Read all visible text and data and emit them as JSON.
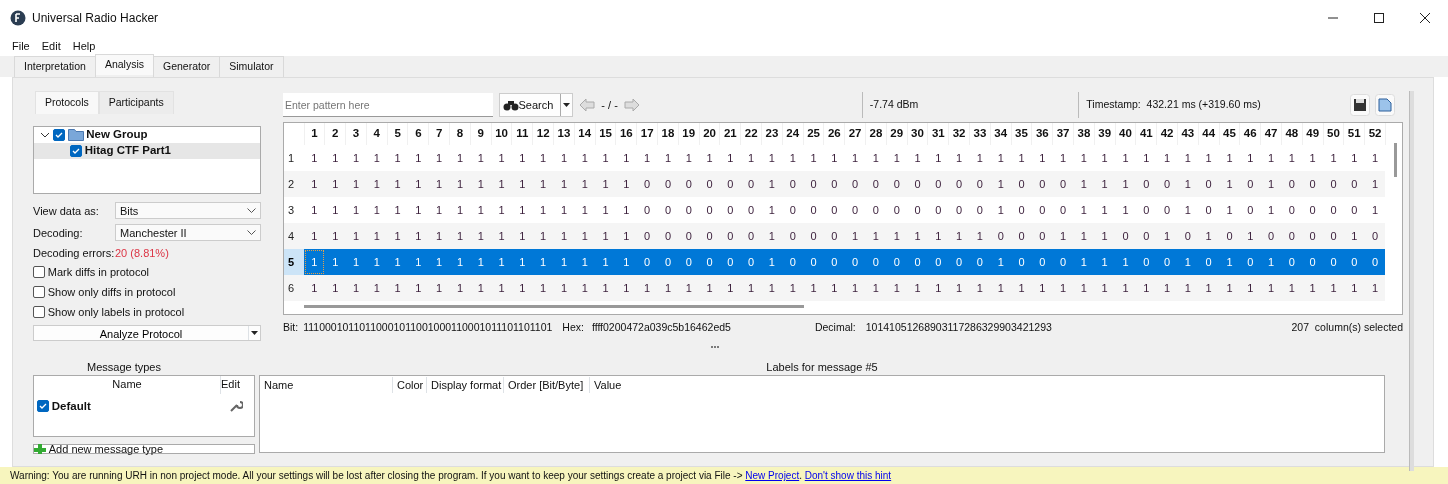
{
  "window": {
    "title": "Universal Radio Hacker"
  },
  "menu": [
    "File",
    "Edit",
    "Help"
  ],
  "tabs": [
    {
      "label": "Interpretation",
      "selected": false
    },
    {
      "label": "Analysis",
      "selected": true
    },
    {
      "label": "Generator",
      "selected": false
    },
    {
      "label": "Simulator",
      "selected": false
    }
  ],
  "protocol_panel": {
    "tabs": [
      {
        "label": "Protocols",
        "selected": true
      },
      {
        "label": "Participants",
        "selected": false
      }
    ],
    "tree": [
      {
        "label": "New Group",
        "checked": true,
        "expanded": true,
        "selected": false,
        "children": [
          {
            "label": "Hitag CTF Part1",
            "checked": true,
            "selected": true
          }
        ]
      }
    ],
    "view_data_as": {
      "label": "View data as:",
      "value": "Bits"
    },
    "decoding": {
      "label": "Decoding:",
      "value": "Manchester II"
    },
    "decoding_errors": {
      "label": "Decoding errors:",
      "value": "20 (8.81%)"
    },
    "options": [
      {
        "label": "Mark diffs in protocol",
        "checked": false
      },
      {
        "label": "Show only diffs in protocol",
        "checked": false
      },
      {
        "label": "Show only labels in protocol",
        "checked": false
      }
    ],
    "analyze_button": "Analyze Protocol"
  },
  "search": {
    "placeholder": "Enter pattern here",
    "button": "Search",
    "position": "- / -"
  },
  "rssi": "-7.74 dBm",
  "timestamp": "Timestamp:  432.21 ms (+319.60 ms)",
  "bit_table": {
    "columns": [
      "1",
      "2",
      "3",
      "4",
      "5",
      "6",
      "7",
      "8",
      "9",
      "10",
      "11",
      "12",
      "13",
      "14",
      "15",
      "16",
      "17",
      "18",
      "19",
      "20",
      "21",
      "22",
      "23",
      "24",
      "25",
      "26",
      "27",
      "28",
      "29",
      "30",
      "31",
      "32",
      "33",
      "34",
      "35",
      "36",
      "37",
      "38",
      "39",
      "40",
      "41",
      "42",
      "43",
      "44",
      "45",
      "46",
      "47",
      "48",
      "49",
      "50",
      "51",
      "52"
    ],
    "rows": [
      {
        "label": "1",
        "cells": [
          "1",
          "1",
          "1",
          "1",
          "1",
          "1",
          "1",
          "1",
          "1",
          "1",
          "1",
          "1",
          "1",
          "1",
          "1",
          "1",
          "1",
          "1",
          "1",
          "1",
          "1",
          "1",
          "1",
          "1",
          "1",
          "1",
          "1",
          "1",
          "1",
          "1",
          "1",
          "1",
          "1",
          "1",
          "1",
          "1",
          "1",
          "1",
          "1",
          "1",
          "1",
          "1",
          "1",
          "1",
          "1",
          "1",
          "1",
          "1",
          "1",
          "1",
          "1",
          "1"
        ],
        "selected": false
      },
      {
        "label": "2",
        "cells": [
          "1",
          "1",
          "1",
          "1",
          "1",
          "1",
          "1",
          "1",
          "1",
          "1",
          "1",
          "1",
          "1",
          "1",
          "1",
          "1",
          "0",
          "0",
          "0",
          "0",
          "0",
          "0",
          "1",
          "0",
          "0",
          "0",
          "0",
          "0",
          "0",
          "0",
          "0",
          "0",
          "0",
          "1",
          "0",
          "0",
          "0",
          "1",
          "1",
          "1",
          "0",
          "0",
          "1",
          "0",
          "1",
          "0",
          "1",
          "0",
          "0",
          "0",
          "0",
          "1"
        ],
        "selected": false
      },
      {
        "label": "3",
        "cells": [
          "1",
          "1",
          "1",
          "1",
          "1",
          "1",
          "1",
          "1",
          "1",
          "1",
          "1",
          "1",
          "1",
          "1",
          "1",
          "1",
          "0",
          "0",
          "0",
          "0",
          "0",
          "0",
          "1",
          "0",
          "0",
          "0",
          "0",
          "0",
          "0",
          "0",
          "0",
          "0",
          "0",
          "1",
          "0",
          "0",
          "0",
          "1",
          "1",
          "1",
          "0",
          "0",
          "1",
          "0",
          "1",
          "0",
          "1",
          "0",
          "0",
          "0",
          "0",
          "1"
        ],
        "selected": false
      },
      {
        "label": "4",
        "cells": [
          "1",
          "1",
          "1",
          "1",
          "1",
          "1",
          "1",
          "1",
          "1",
          "1",
          "1",
          "1",
          "1",
          "1",
          "1",
          "1",
          "0",
          "0",
          "0",
          "0",
          "0",
          "0",
          "1",
          "0",
          "0",
          "0",
          "1",
          "1",
          "1",
          "1",
          "1",
          "1",
          "1",
          "0",
          "0",
          "0",
          "1",
          "1",
          "1",
          "0",
          "0",
          "1",
          "0",
          "1",
          "0",
          "1",
          "0",
          "0",
          "0",
          "0",
          "1",
          "0"
        ],
        "selected": false
      },
      {
        "label": "5",
        "cells": [
          "1",
          "1",
          "1",
          "1",
          "1",
          "1",
          "1",
          "1",
          "1",
          "1",
          "1",
          "1",
          "1",
          "1",
          "1",
          "1",
          "0",
          "0",
          "0",
          "0",
          "0",
          "0",
          "1",
          "0",
          "0",
          "0",
          "0",
          "0",
          "0",
          "0",
          "0",
          "0",
          "0",
          "1",
          "0",
          "0",
          "0",
          "1",
          "1",
          "1",
          "0",
          "0",
          "1",
          "0",
          "1",
          "0",
          "1",
          "0",
          "0",
          "0",
          "0",
          "0"
        ],
        "selected": true
      },
      {
        "label": "6",
        "cells": [
          "1",
          "1",
          "1",
          "1",
          "1",
          "1",
          "1",
          "1",
          "1",
          "1",
          "1",
          "1",
          "1",
          "1",
          "1",
          "1",
          "1",
          "1",
          "1",
          "1",
          "1",
          "1",
          "1",
          "1",
          "1",
          "1",
          "1",
          "1",
          "1",
          "1",
          "1",
          "1",
          "1",
          "1",
          "1",
          "1",
          "1",
          "1",
          "1",
          "1",
          "1",
          "1",
          "1",
          "1",
          "1",
          "1",
          "1",
          "1",
          "1",
          "1",
          "1",
          "1"
        ],
        "selected": false
      }
    ]
  },
  "selection_info": {
    "bit_label": "Bit:",
    "bit": "11100010110110001011001000110001011101101101",
    "hex_label": "Hex:",
    "hex": "ffff0200472a039c5b16462ed5",
    "decimal_label": "Decimal:",
    "decimal": "10141051268903117286329903421293",
    "selected_columns": "207  column(s) selected"
  },
  "message_types": {
    "title": "Message types",
    "columns": [
      "Name",
      "Edit"
    ],
    "rows": [
      {
        "name": "Default",
        "checked": true
      }
    ],
    "add_button": "Add new message type"
  },
  "labels": {
    "title": "Labels for message #5",
    "columns": [
      "Name",
      "Color",
      "Display format",
      "Order [Bit/Byte]",
      "Value"
    ]
  },
  "warning": {
    "text": "Warning: You are running URH in non project mode. All your settings will be lost after closing the program. If you want to keep your settings create a project via File -> ",
    "link": "New Project",
    "separator": ". ",
    "dismiss_link": "Don't show this hint"
  }
}
